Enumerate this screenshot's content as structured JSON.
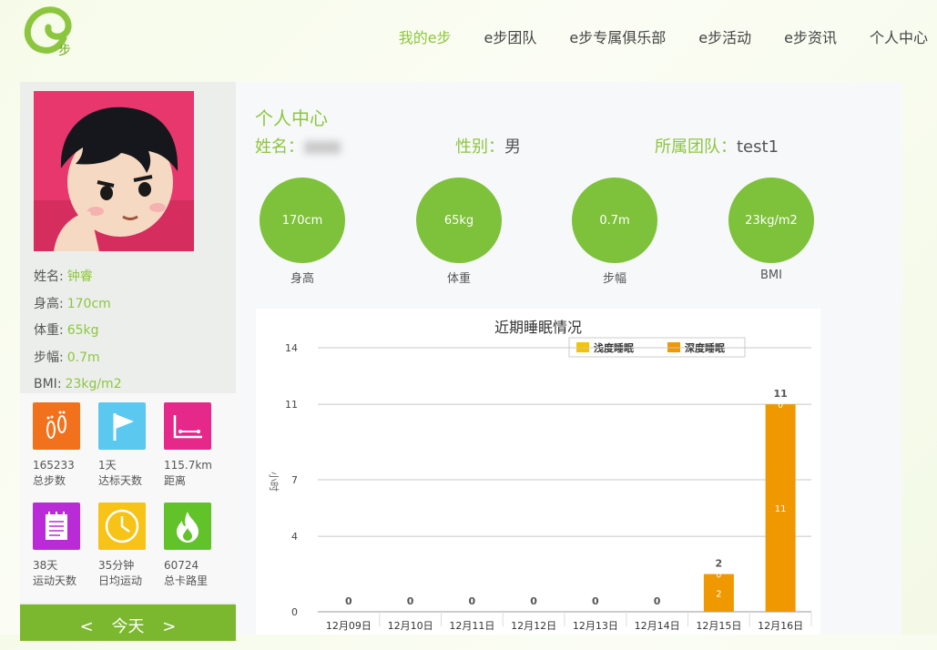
{
  "nav": {
    "items": [
      "我的e步",
      "e步团队",
      "e步专属俱乐部",
      "e步活动",
      "e步资讯",
      "个人中心"
    ],
    "active_index": 0
  },
  "sidebar": {
    "info": [
      {
        "key": "姓名:",
        "value": "钟睿"
      },
      {
        "key": "身高:",
        "value": "170cm"
      },
      {
        "key": "体重:",
        "value": "65kg"
      },
      {
        "key": "步幅:",
        "value": "0.7m"
      },
      {
        "key": "BMI:",
        "value": "23kg/m2"
      }
    ],
    "stats": [
      {
        "icon": "footprints-icon",
        "color": "#f2711c",
        "value": "165233",
        "label": "总步数"
      },
      {
        "icon": "flag-icon",
        "color": "#5bc8f0",
        "value": "1天",
        "label": "达标天数"
      },
      {
        "icon": "distance-icon",
        "color": "#e6288a",
        "value": "115.7km",
        "label": "距离"
      },
      {
        "icon": "calendar-icon",
        "color": "#b92bd6",
        "value": "38天",
        "label": "运动天数"
      },
      {
        "icon": "clock-icon",
        "color": "#f7c317",
        "value": "35分钟",
        "label": "日均运动"
      },
      {
        "icon": "flame-icon",
        "color": "#62c22a",
        "value": "60724",
        "label": "总卡路里"
      }
    ],
    "today": {
      "prev": "<",
      "label": "今天",
      "next": ">"
    }
  },
  "main": {
    "title": "个人中心",
    "name_label": "姓名：",
    "gender_label": "性别：",
    "gender_value": "男",
    "team_label": "所属团队：",
    "team_value": "test1",
    "metrics": [
      {
        "value": "170cm",
        "label": "身高"
      },
      {
        "value": "65kg",
        "label": "体重"
      },
      {
        "value": "0.7m",
        "label": "步幅"
      },
      {
        "value": "23kg/m2",
        "label": "BMI"
      }
    ]
  },
  "colors": {
    "accent": "#8cc63f",
    "circle": "#7ec13a",
    "light_sleep": "#f5c400",
    "deep_sleep": "#ef9800"
  },
  "chart_data": {
    "type": "bar",
    "title": "近期睡眠情况",
    "ylabel": "小时",
    "categories": [
      "12月09日",
      "12月10日",
      "12月11日",
      "12月12日",
      "12月13日",
      "12月14日",
      "12月15日",
      "12月16日"
    ],
    "series": [
      {
        "name": "浅度睡眠",
        "color": "#f5c400",
        "values": [
          0,
          0,
          0,
          0,
          0,
          0,
          0,
          0
        ]
      },
      {
        "name": "深度睡眠",
        "color": "#ef9800",
        "values": [
          0,
          0,
          0,
          0,
          0,
          0,
          2,
          11
        ]
      }
    ],
    "totals": [
      0,
      0,
      0,
      0,
      0,
      0,
      2,
      11
    ],
    "yticks": [
      0,
      4,
      7,
      11,
      14
    ],
    "ylim": [
      0,
      14
    ],
    "legend": "top-right",
    "grid": true
  }
}
